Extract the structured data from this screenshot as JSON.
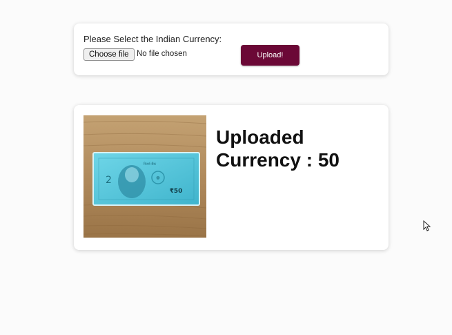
{
  "upload_form": {
    "label": "Please Select the Indian Currency:",
    "choose_file_label": "Choose file",
    "file_status": "No file chosen",
    "upload_label": "Upload!"
  },
  "result": {
    "line1": "Uploaded",
    "line2": "Currency : 50",
    "image_label": "₹50",
    "note_text": "रिजर्व बैंक"
  },
  "colors": {
    "accent": "#6b0836",
    "note": "#54c6dc",
    "wood": "#b08a5c"
  },
  "icons": {
    "cursor": "pointer-cursor-icon"
  }
}
